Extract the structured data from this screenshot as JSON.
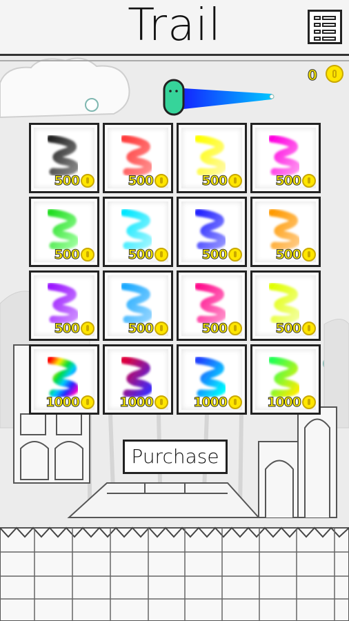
{
  "header": {
    "title": "Trail",
    "menu_icon": "grid-menu-icon"
  },
  "wallet": {
    "coins": "0",
    "coin_icon": "coin-icon"
  },
  "preview": {
    "trail_color_start": "#2a5cff",
    "trail_color_end": "#00b7ff",
    "character_color": "#37d39a"
  },
  "shop": {
    "items": [
      {
        "price": "500",
        "color": "#222222",
        "color2": "#888888"
      },
      {
        "price": "500",
        "color": "#ff3b3b",
        "color2": "#ff8d8d"
      },
      {
        "price": "500",
        "color": "#ffff00",
        "color2": "#fff9a0"
      },
      {
        "price": "500",
        "color": "#ff00e0",
        "color2": "#ff90f0"
      },
      {
        "price": "500",
        "color": "#22dd22",
        "color2": "#9cff9c"
      },
      {
        "price": "500",
        "color": "#00e6ff",
        "color2": "#9cf6ff"
      },
      {
        "price": "500",
        "color": "#2222ff",
        "color2": "#9191ff"
      },
      {
        "price": "500",
        "color": "#ff9a00",
        "color2": "#ffc980"
      },
      {
        "price": "500",
        "color": "#9a14ff",
        "color2": "#cc8cff"
      },
      {
        "price": "500",
        "color": "#1aa9ff",
        "color2": "#8fd3ff"
      },
      {
        "price": "500",
        "color": "#ff0a8c",
        "color2": "#ff8cc8"
      },
      {
        "price": "500",
        "color": "#e0ff00",
        "color2": "#f3ff9a"
      },
      {
        "price": "1000",
        "color": "rainbow",
        "color2": "rainbow"
      },
      {
        "price": "1000",
        "color": "#e0003a",
        "color2": "#3a2bff"
      },
      {
        "price": "1000",
        "color": "#2040ff",
        "color2": "#00ffff"
      },
      {
        "price": "1000",
        "color": "#22ff55",
        "color2": "#ffee00"
      }
    ]
  },
  "actions": {
    "purchase_label": "Purchase"
  }
}
